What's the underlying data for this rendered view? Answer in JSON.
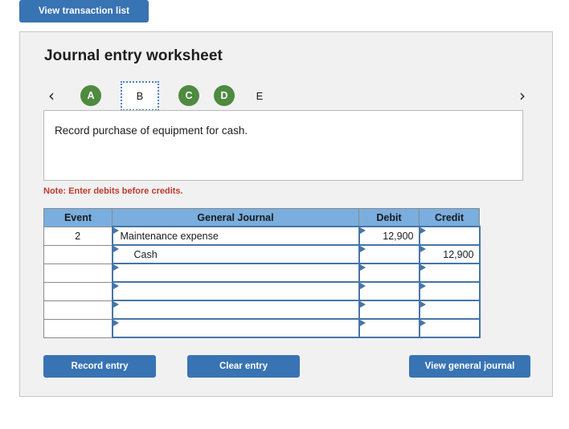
{
  "top_bar": {
    "transaction_list_label": "View transaction list"
  },
  "panel": {
    "title": "Journal entry worksheet",
    "note": "Note: Enter debits before credits.",
    "description": "Record purchase of equipment for cash.",
    "nav": {
      "prev_icon": "chevron-left-icon",
      "next_icon": "chevron-right-icon",
      "prev_glyph": "‹",
      "next_glyph": "›"
    },
    "tabs": [
      {
        "label": "A",
        "state": "complete"
      },
      {
        "label": "B",
        "state": "selected"
      },
      {
        "label": "C",
        "state": "complete"
      },
      {
        "label": "D",
        "state": "complete"
      },
      {
        "label": "E",
        "state": "empty"
      }
    ]
  },
  "table": {
    "headers": [
      "Event",
      "General Journal",
      "Debit",
      "Credit"
    ],
    "rows": [
      {
        "event": "2",
        "account": "Maintenance expense",
        "indent": false,
        "debit": "12,900",
        "credit": ""
      },
      {
        "event": "",
        "account": "Cash",
        "indent": true,
        "debit": "",
        "credit": "12,900"
      },
      {
        "event": "",
        "account": "",
        "indent": false,
        "debit": "",
        "credit": ""
      },
      {
        "event": "",
        "account": "",
        "indent": false,
        "debit": "",
        "credit": ""
      },
      {
        "event": "",
        "account": "",
        "indent": false,
        "debit": "",
        "credit": ""
      },
      {
        "event": "",
        "account": "",
        "indent": false,
        "debit": "",
        "credit": ""
      }
    ]
  },
  "actions": {
    "record_label": "Record entry",
    "clear_label": "Clear entry",
    "journal_label": "View general journal"
  },
  "colors": {
    "button_blue": "#3873b3",
    "header_blue": "#79aede",
    "cell_border_blue": "#4775a8",
    "tab_green": "#4e8a40",
    "note_red": "#c0392b",
    "panel_bg": "#f1f1f1"
  }
}
